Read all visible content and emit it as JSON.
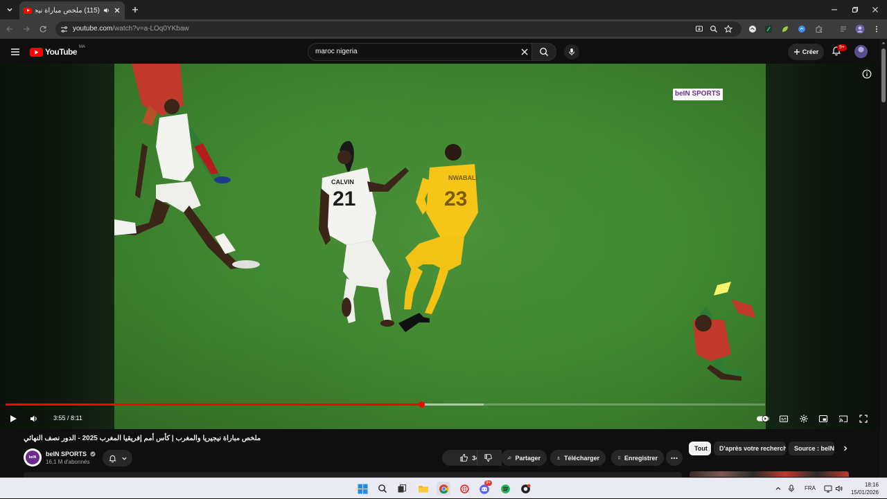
{
  "browser": {
    "tab_title": "(115) ملخص مباراة نيجيريا و...",
    "url_host": "youtube.com",
    "url_path": "/watch?v=a-LOq0YKbaw"
  },
  "yt": {
    "logo_text": "YouTube",
    "region": "MA",
    "search_value": "maroc nigeria",
    "create_label": "Créer",
    "notif_badge": "9+"
  },
  "video": {
    "broadcaster_logo": "beIN SPORTS",
    "time_current": "3:55",
    "time_total": "8:11",
    "time_display": "3:55 / 8:11",
    "progress_played": 0.5472,
    "progress_buffered": 0.63,
    "jerseys": [
      "CALVIN 21",
      "NWABALI 23"
    ]
  },
  "meta": {
    "title": "ملخص مباراة نيجيريا والمغرب | كأس أمم إفريقيا المغرب 2025 - الدور نصف النهائي",
    "channel_name": "beIN SPORTS",
    "channel_avatar": "beIN",
    "subscribers": "16,1 M d'abonnés",
    "likes": "34 k",
    "share_label": "Partager",
    "download_label": "Télécharger",
    "save_label": "Enregistrer"
  },
  "chips": [
    "Tout",
    "D'après votre recherche",
    "Source : beIN S"
  ],
  "taskbar": {
    "lang": "FRA",
    "time": "18:16",
    "date": "15/01/2026",
    "discord_badge": "9+"
  },
  "colors": {
    "accent": "#ff0000",
    "bein_purple": "#6b2a8e",
    "pitch_green": "#438d33"
  }
}
